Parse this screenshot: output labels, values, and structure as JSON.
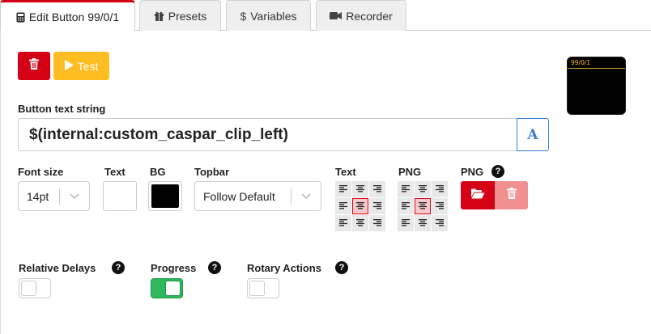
{
  "tabs": [
    {
      "label": "Edit Button 99/0/1",
      "icon": "calculator-icon",
      "active": true
    },
    {
      "label": "Presets",
      "icon": "gift-icon",
      "active": false
    },
    {
      "label": "Variables",
      "icon": "dollar-icon",
      "active": false
    },
    {
      "label": "Recorder",
      "icon": "video-camera-icon",
      "active": false
    }
  ],
  "toolbar": {
    "test_label": "Test"
  },
  "preview": {
    "topbar_text": "99/0/1"
  },
  "text_string": {
    "label": "Button text string",
    "value": "$(internal:custom_caspar_clip_left)"
  },
  "style": {
    "font_size_label": "Font size",
    "font_size_value": "14pt",
    "text_color_label": "Text",
    "bg_label": "BG",
    "topbar_label": "Topbar",
    "topbar_value": "Follow Default",
    "text_align_label": "Text",
    "png_align_label": "PNG",
    "png_label": "PNG",
    "text_alignment": "center-center",
    "png_alignment": "center-center"
  },
  "colors": {
    "text_color": "#ffffff",
    "bg_color": "#000000",
    "brand_red": "#d50215",
    "test_yellow": "#ffbd22",
    "toggle_green": "#2eb85c"
  },
  "options": [
    {
      "label": "Relative Delays",
      "value": false
    },
    {
      "label": "Progress",
      "value": true
    },
    {
      "label": "Rotary Actions",
      "value": false
    }
  ]
}
